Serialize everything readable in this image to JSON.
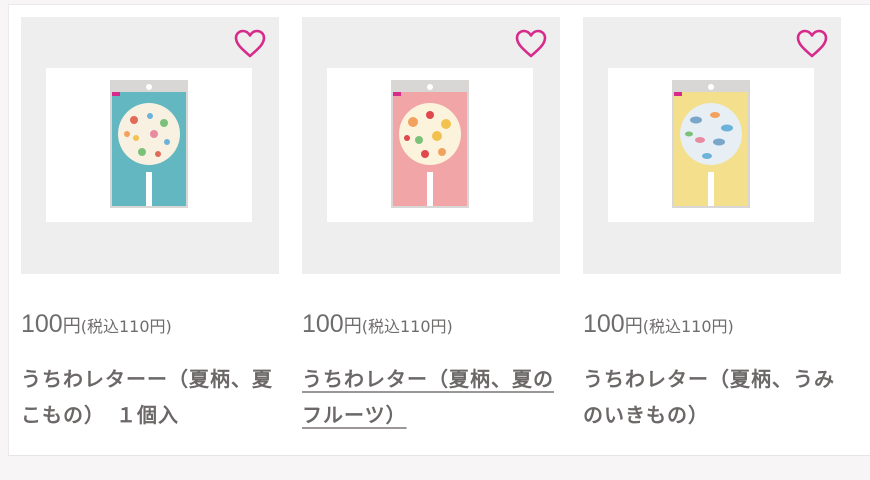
{
  "products": [
    {
      "price": "100",
      "currency": "円",
      "tax_note": "(税込110円)",
      "title": "うちわレターー（夏柄、夏こもの）　１個入",
      "background_color": "#62b7c0",
      "theme": "summer-items",
      "favorite_icon": "heart-outline-icon",
      "link_hovered": false
    },
    {
      "price": "100",
      "currency": "円",
      "tax_note": "(税込110円)",
      "title": "うちわレター（夏柄、夏のフルーツ）",
      "background_color": "#f2a5a6",
      "theme": "summer-fruits",
      "favorite_icon": "heart-outline-icon",
      "link_hovered": true
    },
    {
      "price": "100",
      "currency": "円",
      "tax_note": "(税込110円)",
      "title": "うちわレター（夏柄、うみのいきもの）",
      "background_color": "#f3df8c",
      "theme": "sea-creatures",
      "favorite_icon": "heart-outline-icon",
      "link_hovered": false
    }
  ],
  "colors": {
    "heart": "#d62b8a",
    "text": "#6b6867"
  }
}
